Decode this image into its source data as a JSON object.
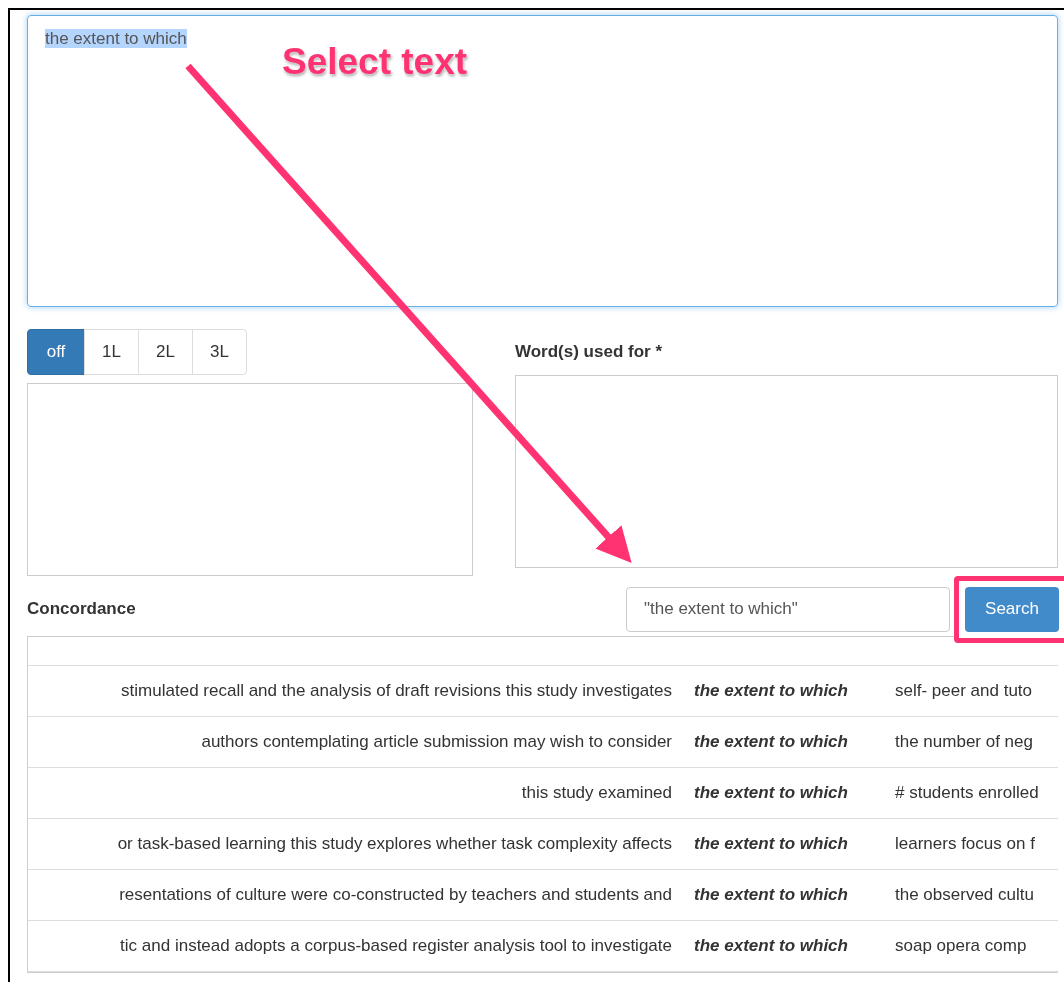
{
  "query_box": {
    "value": "the extent to which",
    "text_selected": true
  },
  "annotation": {
    "label": "Select text"
  },
  "level_buttons": [
    {
      "label": "off",
      "selected": true
    },
    {
      "label": "1L",
      "selected": false
    },
    {
      "label": "2L",
      "selected": false
    },
    {
      "label": "3L",
      "selected": false
    }
  ],
  "words_used_for": {
    "label": "Word(s) used for *"
  },
  "concordance": {
    "title": "Concordance",
    "search_value": "\"the extent to which\"",
    "search_button": "Search",
    "search_highlighted": true,
    "rows": [
      {
        "left": "stimulated recall and the analysis of draft revisions this study investigates",
        "keyword": "the extent to which",
        "right": "self- peer and tuto"
      },
      {
        "left": "authors contemplating article submission may wish to consider",
        "keyword": "the extent to which",
        "right": "the number of neg"
      },
      {
        "left": "this study examined",
        "keyword": "the extent to which",
        "right": "# students enrolled"
      },
      {
        "left": "or task-based learning this study explores whether task complexity affects",
        "keyword": "the extent to which",
        "right": "learners focus on f"
      },
      {
        "left": "resentations of culture were co-constructed by teachers and students and",
        "keyword": "the extent to which",
        "right": "the observed cultu"
      },
      {
        "left": "tic and instead adopts a corpus-based register analysis tool to investigate",
        "keyword": "the extent to which",
        "right": "soap opera comp"
      }
    ]
  }
}
